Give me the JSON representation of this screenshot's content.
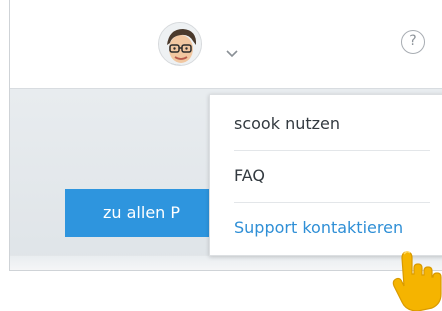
{
  "header": {
    "help_label": "?"
  },
  "main": {
    "primary_button_label": "zu allen P"
  },
  "dropdown": {
    "items": [
      {
        "label": "scook nutzen"
      },
      {
        "label": "FAQ"
      },
      {
        "label": "Support kontaktieren"
      }
    ]
  },
  "colors": {
    "accent_blue": "#2e95de",
    "link_blue": "#2f8fd6",
    "hand_yellow": "#f5b400"
  }
}
